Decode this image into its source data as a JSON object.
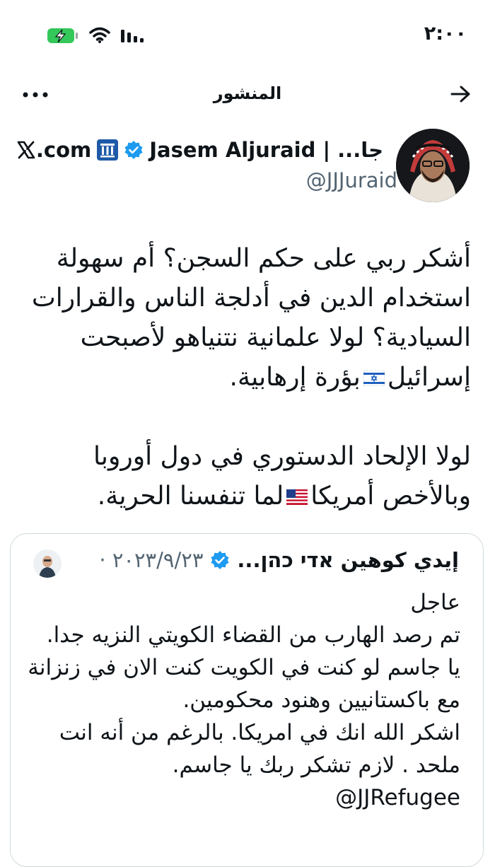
{
  "status": {
    "time": "٢:٠٠"
  },
  "nav": {
    "title": "المنشور"
  },
  "author": {
    "name": "جا... | Jasem Aljuraid",
    "handle": "@JJJuraid",
    "site": ".com",
    "verified": true
  },
  "tweet": {
    "paragraph1_a": "أشكر ربي على حكم السجن؟ أم سهولة استخدام الدين في أدلجة الناس والقرارات السيادية؟ لولا علمانية نتنياهو لأصبحت إسرائيل",
    "paragraph1_b": "بؤرة إرهابية.",
    "paragraph2_a": "لولا الإلحاد الدستوري في دول أوروبا وبالأخص أمريكا",
    "paragraph2_b": "لما تنفسنا الحرية."
  },
  "quote": {
    "date": "٢٠٢٣/٩/٢٣ ·",
    "name": "إيدي كوهين אדי כהן...",
    "body": "عاجل\nتم رصد الهارب من القضاء الكويتي النزيه جدا.\nيا جاسم لو كنت في الكويت كنت الان في زنزانة مع باكستانيين وهنود محكومين.\nاشكر الله انك في امريكا. بالرغم من أنه انت ملحد . لازم تشكر ربك يا جاسم.\nJJRefugee@"
  },
  "colors": {
    "verified": "#1d9bf0",
    "secondary_text": "#536471",
    "battery": "#34c759"
  },
  "icons": [
    "battery-charging-icon",
    "wifi-icon",
    "signal-icon",
    "back-arrow-icon",
    "more-icon",
    "verified-icon",
    "pillar-icon",
    "x-logo-icon",
    "israel-flag-icon",
    "us-flag-icon"
  ]
}
